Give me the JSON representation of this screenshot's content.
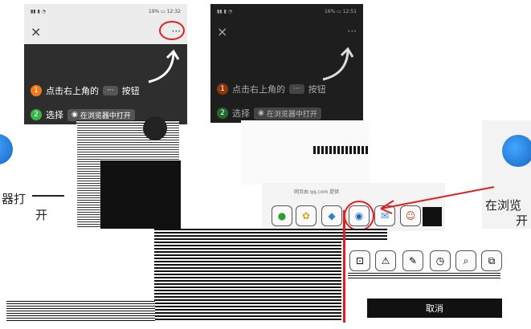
{
  "panel_a": {
    "status_right": "19% ▭ 12:32",
    "close_glyph": "×",
    "more_glyph": "···",
    "step1_num": "1",
    "step1_text": "点击右上角的",
    "step1_button": "···",
    "step1_suffix": "按钮",
    "step2_num": "2",
    "step2_text": "选择",
    "step2_button": "在浏览器中打开"
  },
  "panel_b": {
    "status_right": "16% ▭ 12:51",
    "close_glyph": "×",
    "more_glyph": "···",
    "step1_num": "1",
    "step1_text": "点击右上角的",
    "step1_button": "···",
    "step1_suffix": "按钮",
    "step2_num": "2",
    "step2_text": "选择",
    "step2_button": "在浏览器中打开"
  },
  "left_fragment": {
    "text_line1": "器打",
    "text_line2": "开"
  },
  "right_fragment": {
    "text_line1": "在浏览",
    "text_line2": "开"
  },
  "share_sheet": {
    "source_text": "网页由 qq.com 提供",
    "bottom_button": "取消"
  },
  "colors": {
    "highlight_red": "#e02020",
    "step1_orange": "#f07a1a",
    "step2_green": "#39b54a",
    "dark_bg": "#2e2e2e"
  }
}
